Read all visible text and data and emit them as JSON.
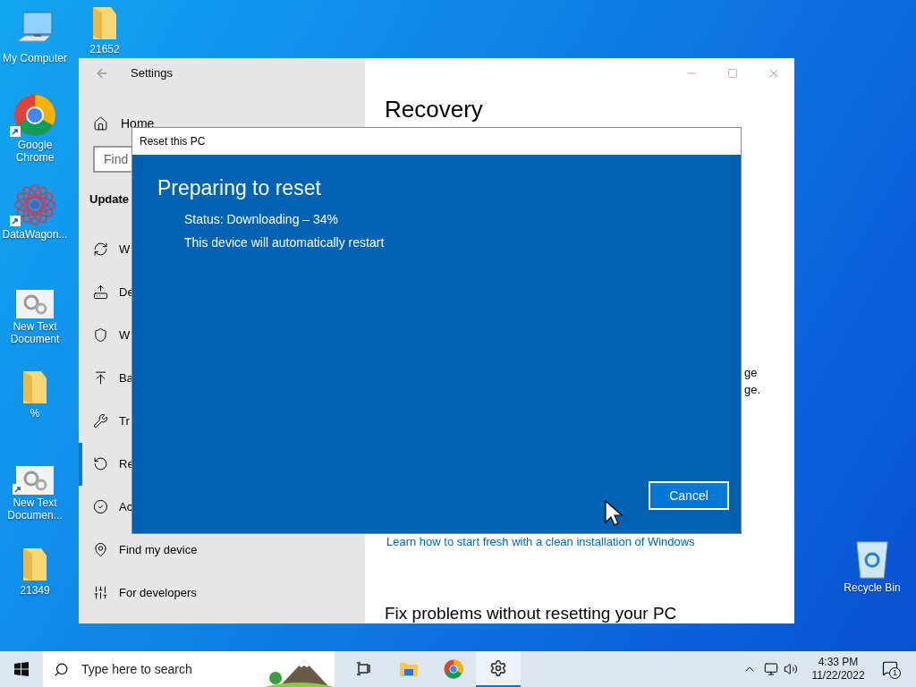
{
  "desktop_icons": [
    {
      "label": "My Computer",
      "kind": "computer",
      "shortcut": false
    },
    {
      "label": "21652",
      "kind": "folder",
      "shortcut": false
    },
    {
      "label": "Google Chrome",
      "kind": "chrome",
      "shortcut": true
    },
    {
      "label": "DataWagon...",
      "kind": "app",
      "shortcut": true
    },
    {
      "label": "New Text Document",
      "kind": "doc",
      "shortcut": false
    },
    {
      "label": "%",
      "kind": "folder",
      "shortcut": false
    },
    {
      "label": "New Text Documen...",
      "kind": "doc",
      "shortcut": true
    },
    {
      "label": "21349",
      "kind": "folder",
      "shortcut": false
    },
    {
      "label": "Recycle Bin",
      "kind": "recycle",
      "shortcut": false
    }
  ],
  "settings": {
    "title": "Settings",
    "home": "Home",
    "search_placeholder": "Find",
    "section": "Update",
    "items": [
      {
        "label": "W",
        "selected": false
      },
      {
        "label": "De",
        "selected": false
      },
      {
        "label": "W",
        "selected": false
      },
      {
        "label": "Ba",
        "selected": false
      },
      {
        "label": "Tr",
        "selected": false
      },
      {
        "label": "Re",
        "selected": true
      },
      {
        "label": "Ac",
        "selected": false
      },
      {
        "label": "Find my device",
        "selected": false
      },
      {
        "label": "For developers",
        "selected": false
      }
    ],
    "heading": "Recovery",
    "fragment_1": "ge",
    "fragment_2": "ge.",
    "link": "Learn how to start fresh with a clean installation of Windows",
    "subheading": "Fix problems without resetting your PC"
  },
  "dialog": {
    "title": "Reset this PC",
    "heading": "Preparing to reset",
    "status": "Status: Downloading – 34%",
    "note": "This device will automatically restart",
    "button": "Cancel"
  },
  "taskbar": {
    "search_placeholder": "Type here to search",
    "apps": [
      {
        "kind": "taskview",
        "selected": false
      },
      {
        "kind": "explorer",
        "selected": false
      },
      {
        "kind": "chrome",
        "selected": false
      },
      {
        "kind": "settings",
        "selected": true
      }
    ],
    "time": "4:33 PM",
    "date": "11/22/2022",
    "notifications": "1"
  }
}
